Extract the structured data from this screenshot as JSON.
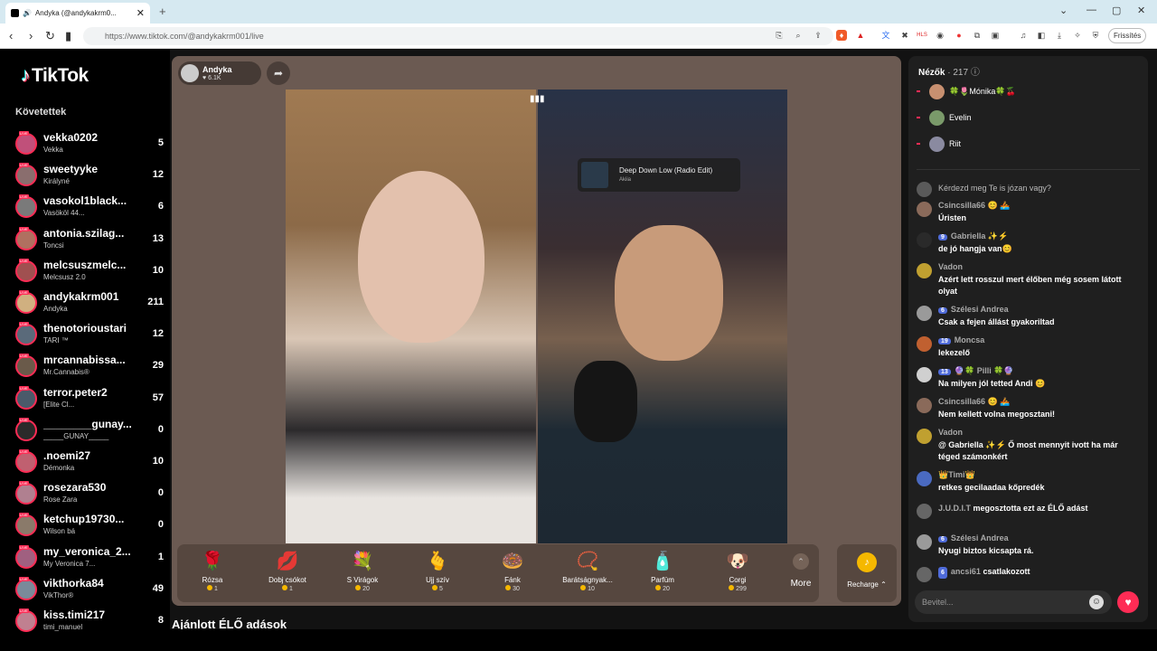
{
  "browser": {
    "tab_title": "Andyka (@andykakrm0...",
    "tab_close": "✕",
    "new_tab": "+",
    "url": "https://www.tiktok.com/@andykakrm001/live",
    "update_button": "Frissítés"
  },
  "sidebar": {
    "logo": "TikTok",
    "following_title": "Követettek",
    "accounts": [
      {
        "name": "vekka0202",
        "sub": "Vekka",
        "count": "5"
      },
      {
        "name": "sweetyyke",
        "sub": "Királyné",
        "count": "12"
      },
      {
        "name": "vasokol1black...",
        "sub": "Vasököl 44...",
        "count": "6"
      },
      {
        "name": "antonia.szilag...",
        "sub": "Toncsi",
        "count": "13"
      },
      {
        "name": "melcsuszmelc...",
        "sub": "Melcsusz 2.0",
        "count": "10"
      },
      {
        "name": "andykakrm001",
        "sub": "Andyka",
        "count": "211"
      },
      {
        "name": "thenotorioustari",
        "sub": "TARI ™",
        "count": "12"
      },
      {
        "name": "mrcannabissa...",
        "sub": "Mr.Cannabis®",
        "count": "29"
      },
      {
        "name": "terror.peter2",
        "sub": "[Elite Cl...",
        "count": "57"
      },
      {
        "name": "________gunay...",
        "sub": "_____GUNAY_____",
        "count": "0"
      },
      {
        "name": ".noemi27",
        "sub": "Démonka",
        "count": "10"
      },
      {
        "name": "rosezara530",
        "sub": "Rose Zara",
        "count": "0"
      },
      {
        "name": "ketchup19730...",
        "sub": "Wilson bá",
        "count": "0"
      },
      {
        "name": "my_veronica_2...",
        "sub": "My Veronica 7...",
        "count": "1"
      },
      {
        "name": "vikthorka84",
        "sub": "VikThor®",
        "count": "49"
      },
      {
        "name": "kiss.timi217",
        "sub": "timi_manuel",
        "count": "8"
      }
    ]
  },
  "stream": {
    "host_name": "Andyka",
    "host_likes": "6.1K",
    "now_playing_title": "Deep Down Low (Radio Edit)",
    "now_playing_artist": "Akiia"
  },
  "gifts": [
    {
      "name": "Rózsa",
      "price": "1",
      "icon": "🌹"
    },
    {
      "name": "Dobj csókot",
      "price": "1",
      "icon": "💋"
    },
    {
      "name": "S Virágok",
      "price": "20",
      "icon": "💐"
    },
    {
      "name": "Ujj szív",
      "price": "5",
      "icon": "🫰"
    },
    {
      "name": "Fánk",
      "price": "30",
      "icon": "🍩"
    },
    {
      "name": "Barátságnyak...",
      "price": "10",
      "icon": "📿"
    },
    {
      "name": "Parfüm",
      "price": "20",
      "icon": "🧴"
    },
    {
      "name": "Corgi",
      "price": "299",
      "icon": "🐶"
    }
  ],
  "more_label": "More",
  "recharge_label": "Recharge",
  "recommended_title": "Ajánlott ÉLŐ adások",
  "viewers": {
    "title": "Nézők",
    "count": "· 217",
    "list": [
      {
        "name": "🍀🌷Mónika🍀🍒"
      },
      {
        "name": "Evelin"
      },
      {
        "name": "Riit"
      }
    ]
  },
  "chat": [
    {
      "user": "",
      "badge": "",
      "msg": "Kérdezd meg Te is józan vagy?"
    },
    {
      "user": "Csincsilla66 😊 🚣",
      "badge": "",
      "msg": "Úristen"
    },
    {
      "user": "Gabriella ✨⚡",
      "badge": "9",
      "msg": "de jó hangja van😊"
    },
    {
      "user": "Vadon",
      "badge": "",
      "msg": "Azért lett rosszul mert élőben még sosem látott olyat"
    },
    {
      "user": "Szélesi Andrea",
      "badge": "6",
      "msg": "Csak a fejen állást gyakoriltad"
    },
    {
      "user": "Moncsa",
      "badge": "19",
      "msg": "lekezelő"
    },
    {
      "user": "🔮🍀 Pilli 🍀🔮",
      "badge": "13",
      "msg": "Na milyen jól tetted Andi 😊"
    },
    {
      "user": "Csincsilla66 😊 🚣",
      "badge": "",
      "msg": "Nem kellett volna megosztani!"
    },
    {
      "user": "Vadon",
      "badge": "",
      "msg": "@ Gabriella ✨⚡ Ő most mennyit ivott ha már téged számonkért"
    },
    {
      "user": "👑Timi👑",
      "badge": "",
      "msg": "retkes gecilaadaa kőpredék"
    },
    {
      "user": "J.U.D.I.T",
      "badge": "",
      "msg": "megosztotta ezt az ÉLŐ adást"
    },
    {
      "user": "Szélesi Andrea",
      "badge": "6",
      "msg": "Nyugi biztos kicsapta rá."
    },
    {
      "user": "ancsi61",
      "badge": "6",
      "msg": "csatlakozott"
    }
  ],
  "input_placeholder": "Bevitel..."
}
